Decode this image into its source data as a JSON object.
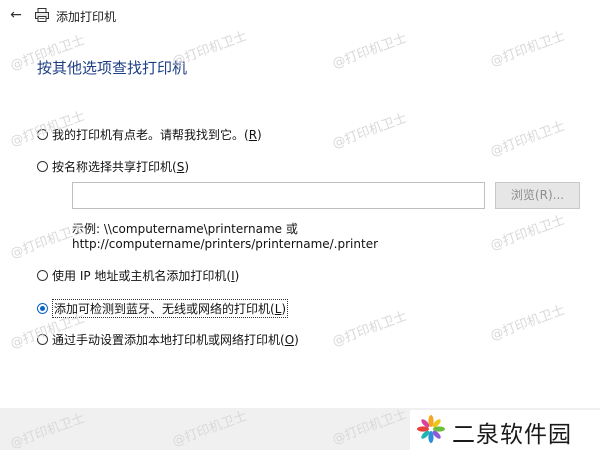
{
  "window": {
    "title": "添加打印机",
    "back_icon": "back-arrow-icon",
    "title_icon": "printer-icon"
  },
  "heading": "按其他选项查找打印机",
  "options": [
    {
      "label": "我的打印机有点老。请帮我找到它。",
      "key": "R",
      "checked": false
    },
    {
      "label": "按名称选择共享打印机",
      "key": "S",
      "checked": false
    },
    {
      "label": "使用 IP 地址或主机名添加打印机",
      "key": "I",
      "checked": false
    },
    {
      "label": "添加可检测到蓝牙、无线或网络的打印机",
      "key": "L",
      "checked": true
    },
    {
      "label": "通过手动设置添加本地打印机或网络打印机",
      "key": "O",
      "checked": false
    }
  ],
  "shared_printer": {
    "value": "",
    "browse_label": "浏览(R)...",
    "example_line1": "示例: \\\\computername\\printername 或",
    "example_line2": "http://computername/printers/printername/.printer"
  },
  "watermark": "@打印机卫士",
  "logo": {
    "text": "二泉软件园",
    "icon": "pinwheel-logo-icon"
  },
  "colors": {
    "heading": "#1e3f86",
    "accent": "#0a64c8",
    "footer": "#f0f0f0",
    "disabled_button": "#e6e6e6"
  }
}
